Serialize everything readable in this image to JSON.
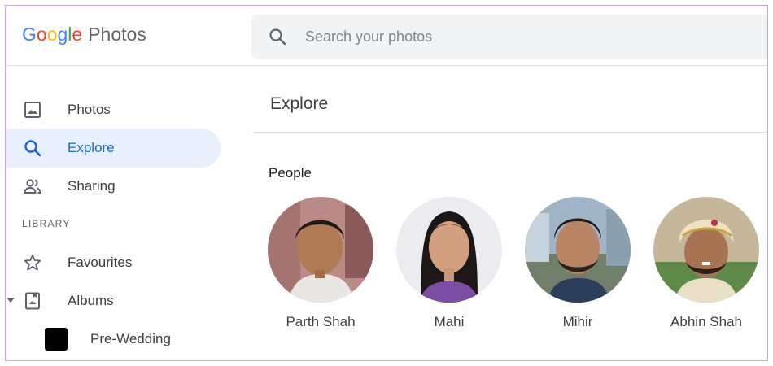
{
  "app": {
    "logo_letters": [
      "G",
      "o",
      "o",
      "g",
      "l",
      "e"
    ],
    "product": "Photos"
  },
  "search": {
    "placeholder": "Search your photos"
  },
  "sidebar": {
    "items": [
      {
        "label": "Photos",
        "icon": "photo-icon",
        "active": false
      },
      {
        "label": "Explore",
        "icon": "search-icon",
        "active": true
      },
      {
        "label": "Sharing",
        "icon": "people-icon",
        "active": false
      }
    ],
    "library_label": "LIBRARY",
    "library_items": [
      {
        "label": "Favourites",
        "icon": "star-icon"
      },
      {
        "label": "Albums",
        "icon": "album-icon"
      }
    ],
    "albums": [
      {
        "label": "Pre-Wedding"
      }
    ]
  },
  "main": {
    "title": "Explore",
    "people_heading": "People",
    "people": [
      {
        "name": "Parth Shah"
      },
      {
        "name": "Mahi"
      },
      {
        "name": "Mihir"
      },
      {
        "name": "Abhin Shah"
      }
    ]
  },
  "colors": {
    "accent": "#1967d2",
    "active_bg": "#e8f0fe",
    "search_bg": "#f1f3f4",
    "frame_border": "#c9a6d6"
  }
}
